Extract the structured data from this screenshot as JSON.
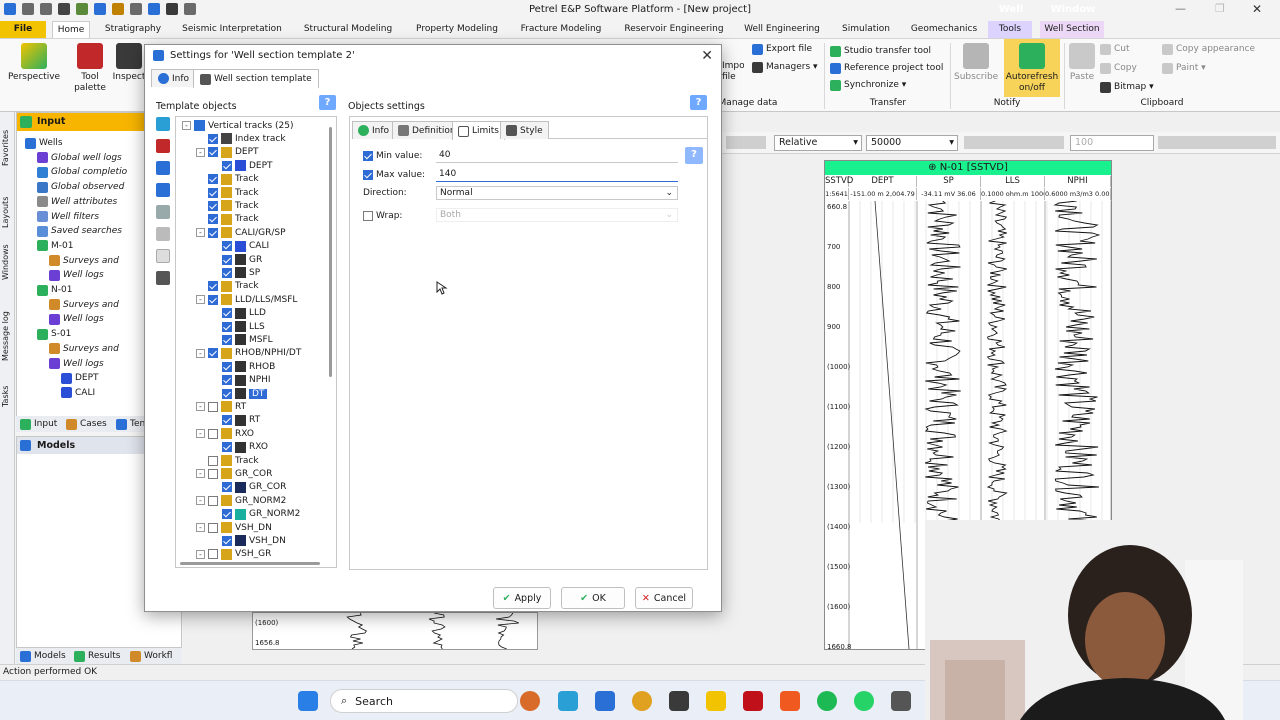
{
  "app": {
    "title": "Petrel E&P Software Platform - [New project]",
    "context_tabs": [
      {
        "label": "Well",
        "color": "#7a5cff"
      },
      {
        "label": "Window",
        "color": "#b06ad8"
      }
    ],
    "status": "Action performed OK"
  },
  "ribbon_tabs": [
    "File",
    "Home",
    "Stratigraphy",
    "Seismic Interpretation",
    "Structural Modeling",
    "Property Modeling",
    "Fracture Modeling",
    "Reservoir Engineering",
    "Well Engineering",
    "Simulation",
    "Geomechanics",
    "Tools",
    "Well Section"
  ],
  "ribbon": {
    "perspective": "Perspective",
    "tool_palette": "Tool palette",
    "inspect": "Inspect",
    "import_file": "Import file",
    "export_file": "Export file",
    "managers": "Managers",
    "manage_data": "Manage data",
    "studio_transfer_tool": "Studio transfer tool",
    "reference_project_tool": "Reference project tool",
    "synchronize": "Synchronize",
    "transfer": "Transfer",
    "subscribe": "Subscribe",
    "autorefresh": "Autorefresh on/off",
    "notify": "Notify",
    "paste": "Paste",
    "cut": "Cut",
    "copy": "Copy",
    "bitmap": "Bitmap",
    "copy_appearance": "Copy appearance",
    "paint": "Paint",
    "clipboard": "Clipboard"
  },
  "side_tabs": [
    "Favorites",
    "Layouts",
    "Windows",
    "Message log",
    "Tasks"
  ],
  "input_panel": {
    "title": "Input",
    "items": [
      {
        "label": "Wells",
        "italic": false,
        "indent": 0,
        "icon": "#2a6fd6"
      },
      {
        "label": "Global well logs",
        "italic": true,
        "indent": 1,
        "icon": "#6b3fd3"
      },
      {
        "label": "Global completio",
        "italic": true,
        "indent": 1,
        "icon": "#2f7fd4"
      },
      {
        "label": "Global observed",
        "italic": true,
        "indent": 1,
        "icon": "#3a78c7"
      },
      {
        "label": "Well attributes",
        "italic": true,
        "indent": 1,
        "icon": "#8a8a8a"
      },
      {
        "label": "Well filters",
        "italic": true,
        "indent": 1,
        "icon": "#6a8fd6"
      },
      {
        "label": "Saved searches",
        "italic": true,
        "indent": 1,
        "icon": "#5a8ed8"
      },
      {
        "label": "M-01",
        "italic": false,
        "indent": 1,
        "icon": "#2cb05c"
      },
      {
        "label": "Surveys and",
        "italic": true,
        "indent": 2,
        "icon": "#d08a2a"
      },
      {
        "label": "Well logs",
        "italic": true,
        "indent": 2,
        "icon": "#6b3fd3"
      },
      {
        "label": "N-01",
        "italic": false,
        "indent": 1,
        "icon": "#2cb05c"
      },
      {
        "label": "Surveys and",
        "italic": true,
        "indent": 2,
        "icon": "#d08a2a"
      },
      {
        "label": "Well logs",
        "italic": true,
        "indent": 2,
        "icon": "#6b3fd3"
      },
      {
        "label": "S-01",
        "italic": false,
        "indent": 1,
        "icon": "#2cb05c"
      },
      {
        "label": "Surveys and",
        "italic": true,
        "indent": 2,
        "icon": "#d08a2a"
      },
      {
        "label": "Well logs",
        "italic": true,
        "indent": 2,
        "icon": "#6b3fd3"
      },
      {
        "label": "DEPT",
        "italic": false,
        "indent": 3,
        "icon": "#2a4fd6"
      },
      {
        "label": "CALI",
        "italic": false,
        "indent": 3,
        "icon": "#2a4fd6"
      }
    ],
    "tabs": [
      "Input",
      "Cases",
      "Ten"
    ]
  },
  "models_panel": {
    "title": "Models",
    "tabs": [
      "Models",
      "Results",
      "Workfl"
    ]
  },
  "well_toolbar": {
    "mode": "Relative",
    "scale": "50000",
    "zoom": "100"
  },
  "well_section": {
    "header": "N-01 [SSTVD]",
    "columns": [
      {
        "name": "SSTVD",
        "sub": "1:5641"
      },
      {
        "name": "DEPT",
        "sub": "-151.00 m 2,004.79"
      },
      {
        "name": "SP",
        "sub": "-34.11 mV 36.06"
      },
      {
        "name": "LLS",
        "sub": "0.1000 ohm.m 100000"
      },
      {
        "name": "NPHI",
        "sub": "0.6000 m3/m3 0.0000"
      }
    ],
    "depths": [
      "660.8",
      "700",
      "800",
      "900",
      "(1000)",
      "(1100)",
      "(1200)",
      "(1300)",
      "(1400)",
      "(1500)",
      "(1600)",
      "1660.8"
    ],
    "bottom_depths": [
      "(1600)",
      "1656.8"
    ]
  },
  "dialog": {
    "title": "Settings for 'Well section template 2'",
    "tabs": [
      "Info",
      "Well section template"
    ],
    "template_objects_label": "Template objects",
    "objects_settings_label": "Objects settings",
    "tree": [
      {
        "label": "Vertical tracks (25)",
        "level": 0,
        "exp": "-",
        "cb": null,
        "icon": "#2a6fd6"
      },
      {
        "label": "Index track",
        "level": 1,
        "exp": "",
        "cb": true,
        "icon": "#444"
      },
      {
        "label": "DEPT",
        "level": 1,
        "exp": "-",
        "cb": true,
        "icon": "#d6a51a"
      },
      {
        "label": "DEPT",
        "level": 2,
        "exp": "",
        "cb": true,
        "icon": "#2a4fd6"
      },
      {
        "label": "Track",
        "level": 1,
        "exp": "",
        "cb": true,
        "icon": "#d6a51a"
      },
      {
        "label": "Track",
        "level": 1,
        "exp": "",
        "cb": true,
        "icon": "#d6a51a"
      },
      {
        "label": "Track",
        "level": 1,
        "exp": "",
        "cb": true,
        "icon": "#d6a51a"
      },
      {
        "label": "Track",
        "level": 1,
        "exp": "",
        "cb": true,
        "icon": "#d6a51a"
      },
      {
        "label": "CALI/GR/SP",
        "level": 1,
        "exp": "-",
        "cb": true,
        "icon": "#d6a51a"
      },
      {
        "label": "CALI",
        "level": 2,
        "exp": "",
        "cb": true,
        "icon": "#2a4fd6"
      },
      {
        "label": "GR",
        "level": 2,
        "exp": "",
        "cb": true,
        "icon": "#333"
      },
      {
        "label": "SP",
        "level": 2,
        "exp": "",
        "cb": true,
        "icon": "#333"
      },
      {
        "label": "Track",
        "level": 1,
        "exp": "",
        "cb": true,
        "icon": "#d6a51a"
      },
      {
        "label": "LLD/LLS/MSFL",
        "level": 1,
        "exp": "-",
        "cb": true,
        "icon": "#d6a51a"
      },
      {
        "label": "LLD",
        "level": 2,
        "exp": "",
        "cb": true,
        "icon": "#333"
      },
      {
        "label": "LLS",
        "level": 2,
        "exp": "",
        "cb": true,
        "icon": "#333"
      },
      {
        "label": "MSFL",
        "level": 2,
        "exp": "",
        "cb": true,
        "icon": "#333"
      },
      {
        "label": "RHOB/NPHI/DT",
        "level": 1,
        "exp": "-",
        "cb": true,
        "icon": "#d6a51a"
      },
      {
        "label": "RHOB",
        "level": 2,
        "exp": "",
        "cb": true,
        "icon": "#333"
      },
      {
        "label": "NPHI",
        "level": 2,
        "exp": "",
        "cb": true,
        "icon": "#333"
      },
      {
        "label": "DT",
        "level": 2,
        "exp": "",
        "cb": true,
        "icon": "#333",
        "selected": true
      },
      {
        "label": "RT",
        "level": 1,
        "exp": "-",
        "cb": false,
        "icon": "#d6a51a"
      },
      {
        "label": "RT",
        "level": 2,
        "exp": "",
        "cb": true,
        "icon": "#333"
      },
      {
        "label": "RXO",
        "level": 1,
        "exp": "-",
        "cb": false,
        "icon": "#d6a51a"
      },
      {
        "label": "RXO",
        "level": 2,
        "exp": "",
        "cb": true,
        "icon": "#333"
      },
      {
        "label": "Track",
        "level": 1,
        "exp": "",
        "cb": false,
        "icon": "#d6a51a"
      },
      {
        "label": "GR_COR",
        "level": 1,
        "exp": "-",
        "cb": false,
        "icon": "#d6a51a"
      },
      {
        "label": "GR_COR",
        "level": 2,
        "exp": "",
        "cb": true,
        "icon": "#1a2a5a"
      },
      {
        "label": "GR_NORM2",
        "level": 1,
        "exp": "-",
        "cb": false,
        "icon": "#d6a51a"
      },
      {
        "label": "GR_NORM2",
        "level": 2,
        "exp": "",
        "cb": true,
        "icon": "#1ab0a0"
      },
      {
        "label": "VSH_DN",
        "level": 1,
        "exp": "-",
        "cb": false,
        "icon": "#d6a51a"
      },
      {
        "label": "VSH_DN",
        "level": 2,
        "exp": "",
        "cb": true,
        "icon": "#1a2a5a"
      },
      {
        "label": "VSH_GR",
        "level": 1,
        "exp": "-",
        "cb": false,
        "icon": "#d6a51a"
      }
    ],
    "settings_tabs": [
      "Info",
      "Definition",
      "Limits",
      "Style"
    ],
    "limits": {
      "min_label": "Min value:",
      "min_value": "40",
      "max_label": "Max value:",
      "max_value": "140",
      "direction_label": "Direction:",
      "direction_value": "Normal",
      "wrap_label": "Wrap:",
      "wrap_value": "Both"
    },
    "buttons": {
      "apply": "Apply",
      "ok": "OK",
      "cancel": "Cancel"
    }
  },
  "taskbar": {
    "search": "Search"
  }
}
